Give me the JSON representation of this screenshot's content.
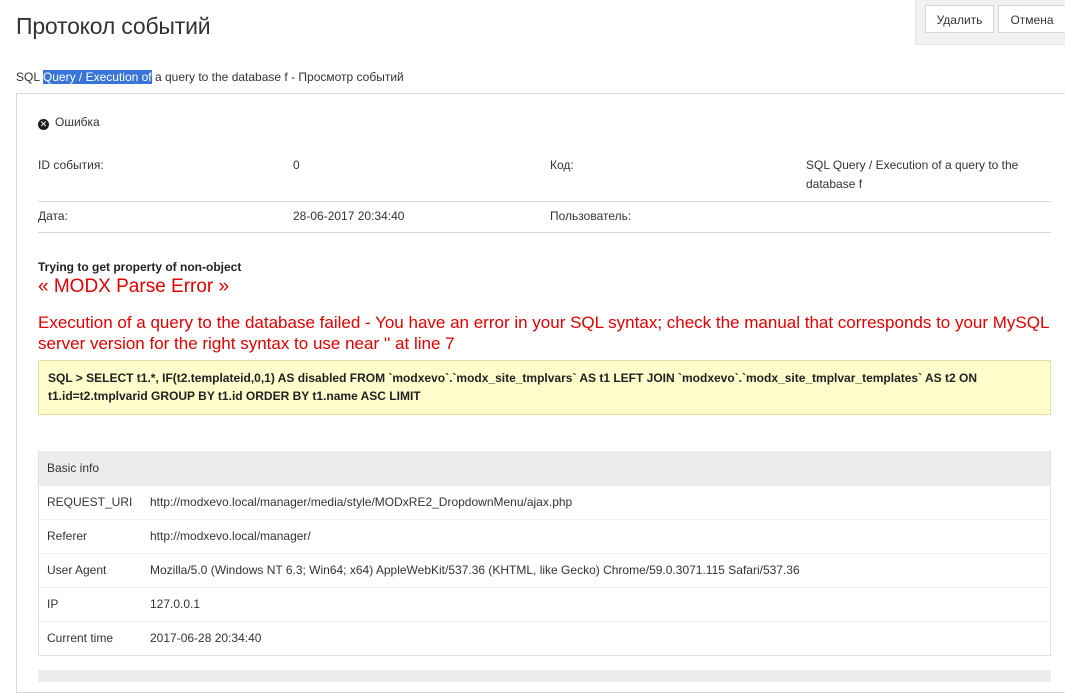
{
  "header": {
    "title": "Протокол событий",
    "delete_label": "Удалить",
    "cancel_label": "Отмена"
  },
  "breadcrumb": {
    "prefix": "SQL ",
    "selected": "Query / Execution of",
    "suffix": " a query to the database f - Просмотр событий"
  },
  "event": {
    "status_label": "Ошибка",
    "id_label": "ID события:",
    "id_value": "0",
    "code_label": "Код:",
    "code_value": "SQL Query / Execution of a query to the database f",
    "date_label": "Дата:",
    "date_value": "28-06-2017 20:34:40",
    "user_label": "Пользователь:",
    "user_value": ""
  },
  "error": {
    "warning": "Trying to get property of non-object",
    "parse_title": "« MODX Parse Error »",
    "message": "Execution of a query to the database failed - You have an error in your SQL syntax; check the manual that corresponds to your MySQL server version for the right syntax to use near '' at line 7",
    "sql": "SQL > SELECT t1.*, IF(t2.templateid,0,1) AS disabled FROM `modxevo`.`modx_site_tmplvars` AS t1 LEFT JOIN `modxevo`.`modx_site_tmplvar_templates` AS t2 ON t1.id=t2.tmplvarid GROUP BY t1.id ORDER BY t1.name ASC LIMIT"
  },
  "basic_info": {
    "heading": "Basic info",
    "rows": [
      {
        "key": "REQUEST_URI",
        "value": "http://modxevo.local/manager/media/style/MODxRE2_DropdownMenu/ajax.php"
      },
      {
        "key": "Referer",
        "value": "http://modxevo.local/manager/"
      },
      {
        "key": "User Agent",
        "value": "Mozilla/5.0 (Windows NT 6.3; Win64; x64) AppleWebKit/537.36 (KHTML, like Gecko) Chrome/59.0.3071.115 Safari/537.36"
      },
      {
        "key": "IP",
        "value": "127.0.0.1"
      },
      {
        "key": "Current time",
        "value": "2017-06-28 20:34:40"
      }
    ]
  },
  "icons": {
    "status": "error-circle-icon"
  }
}
